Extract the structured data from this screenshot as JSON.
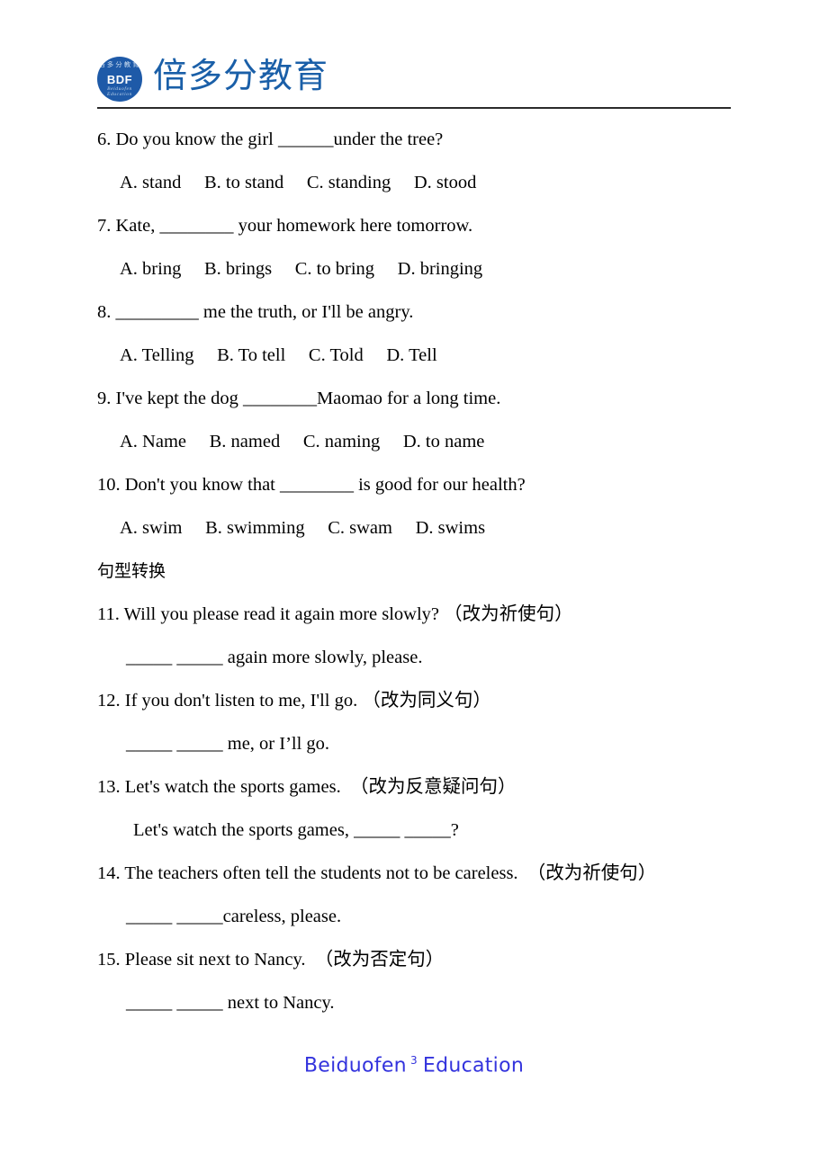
{
  "header": {
    "logo": {
      "ring_top_text": "倍多分教育",
      "monogram": "BDF",
      "ring_bottom_text": "Beiduofen Education"
    },
    "brand_title": "倍多分教育"
  },
  "content": {
    "questions": [
      {
        "text": "6. Do you know the girl ______under the tree?",
        "options": "A. stand     B. to stand     C. standing     D. stood"
      },
      {
        "text": "7. Kate, ________ your homework here tomorrow.",
        "options": "A. bring     B. brings     C. to bring     D. bringing"
      },
      {
        "text": "8. _________ me the truth, or I'll be angry.",
        "options": "A. Telling     B. To tell     C. Told     D. Tell"
      },
      {
        "text": "9. I've kept the dog ________Maomao for a long time.",
        "options": "A. Name     B. named     C. naming     D. to name"
      },
      {
        "text": "10. Don't you know that ________ is good for our health?",
        "options": "A. swim     B. swimming     C. swam     D. swims"
      }
    ],
    "section_heading": "句型转换",
    "transform_questions": [
      {
        "text": "11. Will you please read it again more slowly? （改为祈使句）",
        "answer": "_____ _____ again more slowly, please.",
        "answer_indent": "normal"
      },
      {
        "text": "12. If you don't listen to me, I'll go. （改为同义句）",
        "answer": "_____ _____ me, or I’ll go.",
        "answer_indent": "normal"
      },
      {
        "text": "13. Let's watch the sports games.　（改为反意疑问句）",
        "answer": "Let's watch the sports games, _____ _____?",
        "answer_indent": "wide"
      },
      {
        "text": "14. The teachers often tell the students not to be careless.　（改为祈使句）",
        "answer": "_____ _____careless, please.",
        "answer_indent": "normal"
      },
      {
        "text": "15. Please sit next to Nancy.　（改为否定句）",
        "answer": "_____ _____ next to Nancy.",
        "answer_indent": "normal"
      }
    ]
  },
  "footer": {
    "left_text": "Beiduofen",
    "page_number": "3",
    "right_text": "Education"
  },
  "colors": {
    "brand_blue": "#1a5fa8",
    "logo_blue": "#1e5aa8",
    "footer_blue": "#3333dd",
    "rule": "#2b2b2b"
  }
}
